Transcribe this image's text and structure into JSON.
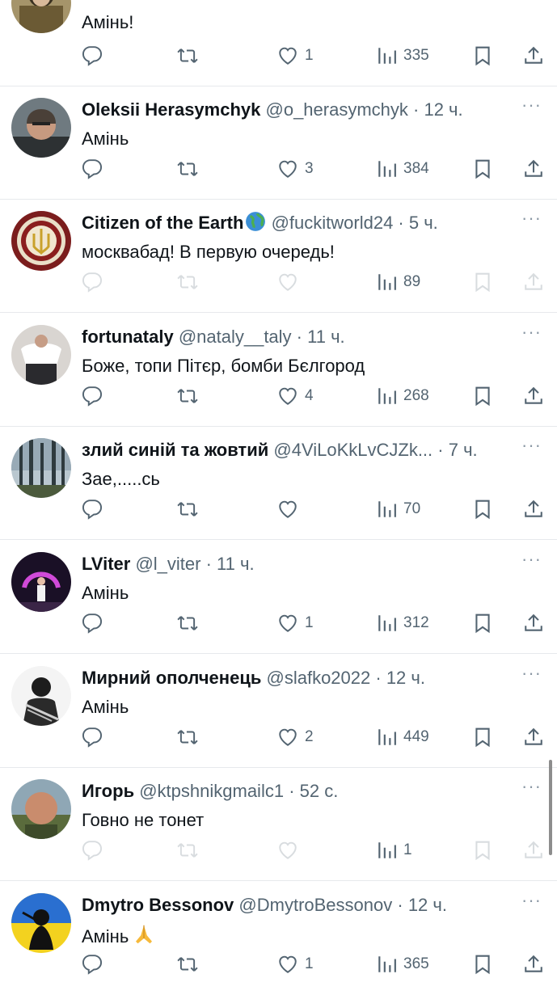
{
  "tweets": [
    {
      "name": "",
      "handle": "",
      "time": "",
      "text": "Амінь!",
      "likes": "1",
      "views": "335",
      "disabled": false
    },
    {
      "name": "Oleksii Herasymchyk",
      "handle": "@o_herasymchyk",
      "time": "12 ч.",
      "text": "Амінь",
      "likes": "3",
      "views": "384",
      "disabled": false
    },
    {
      "name": "Citizen of the Earth",
      "handle": "@fuckitworld24",
      "time": "5 ч.",
      "text": "москвабад! В первую очередь!",
      "likes": "",
      "views": "89",
      "disabled": true
    },
    {
      "name": "fortunataly",
      "handle": "@nataly__taly",
      "time": "11 ч.",
      "text": "Боже, топи Пітєр, бомби Бєлгород",
      "likes": "4",
      "views": "268",
      "disabled": false
    },
    {
      "name": "злий синій та жовтий",
      "handle": "@4ViLoKkLvCJZk...",
      "time": "7 ч.",
      "text": "Зае,.....сь",
      "likes": "",
      "views": "70",
      "disabled": false
    },
    {
      "name": "LViter",
      "handle": "@l_viter",
      "time": "11 ч.",
      "text": "Амінь",
      "likes": "1",
      "views": "312",
      "disabled": false
    },
    {
      "name": "Мирний ополченець",
      "handle": "@slafko2022",
      "time": "12 ч.",
      "text": "Амінь",
      "likes": "2",
      "views": "449",
      "disabled": false
    },
    {
      "name": "Игорь",
      "handle": "@ktpshnikgmailc1",
      "time": "52 с.",
      "text": "Говно не тонет",
      "likes": "",
      "views": "1",
      "disabled": true
    },
    {
      "name": "Dmytro Bessonov",
      "handle": "@DmytroBessonov",
      "time": "12 ч.",
      "text": "Амінь",
      "likes": "1",
      "views": "365",
      "disabled": false
    }
  ],
  "dot_separator": "·",
  "more_label": "···",
  "colors": {
    "text": "#0f1419",
    "muted": "#536471",
    "divider": "#e7e9ec",
    "scrollbar": "#8d8d8d"
  },
  "icons": [
    "reply-icon",
    "retweet-icon",
    "like-icon",
    "views-icon",
    "bookmark-icon",
    "share-icon",
    "more-icon"
  ]
}
